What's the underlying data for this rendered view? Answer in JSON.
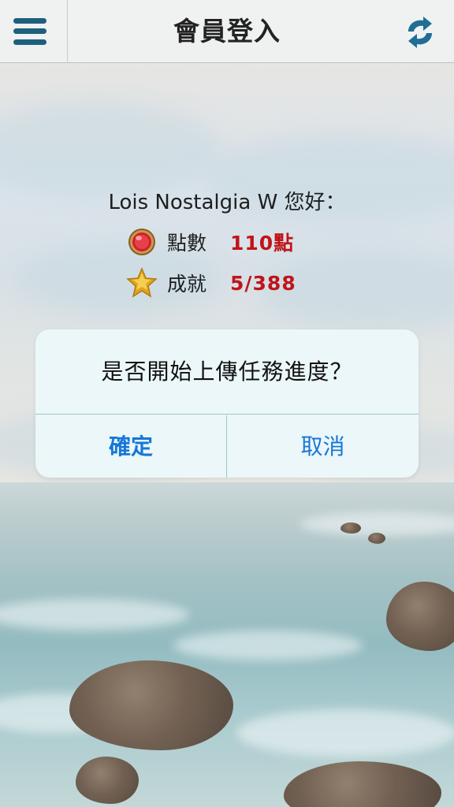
{
  "header": {
    "title": "會員登入",
    "menu_icon": "hamburger-menu-icon",
    "sync_icon": "sync-refresh-icon"
  },
  "member": {
    "greeting": "Lois Nostalgia W 您好：",
    "points_label": "點數",
    "points_value": "110點",
    "achievement_label": "成就",
    "achievement_value": "5/388",
    "points_icon": "red-gem-icon",
    "achievement_icon": "gold-star-icon"
  },
  "dialog": {
    "message": "是否開始上傳任務進度？",
    "confirm_label": "確定",
    "cancel_label": "取消"
  },
  "colors": {
    "accent": "#1f5f7e",
    "value_red": "#c0141a",
    "dialog_button": "#1677d6"
  }
}
